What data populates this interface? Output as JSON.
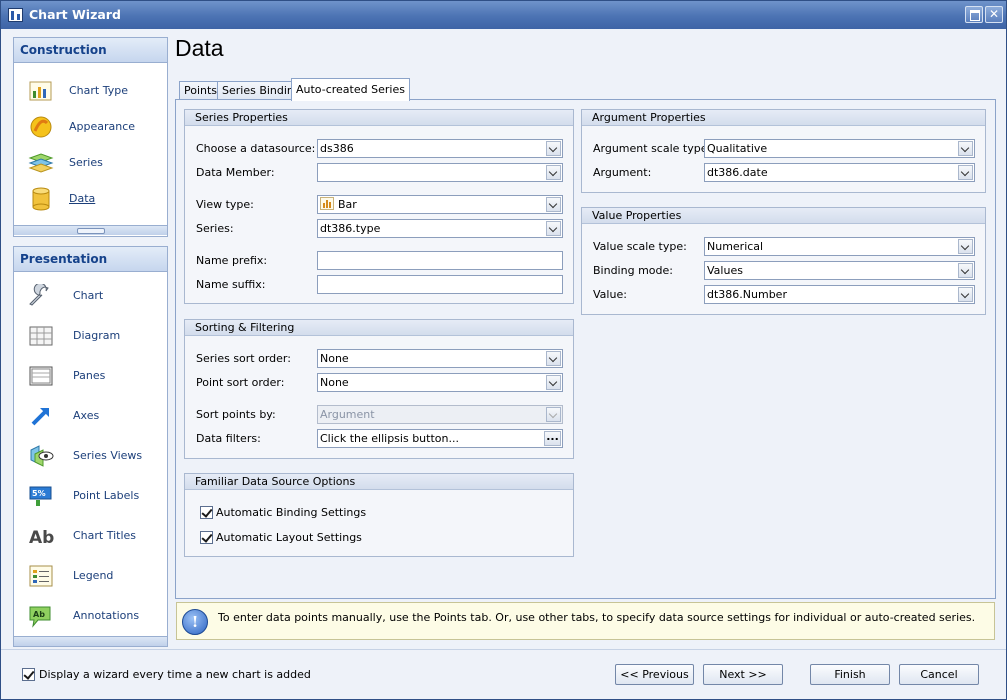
{
  "window": {
    "title": "Chart Wizard"
  },
  "nav": {
    "construction": {
      "header": "Construction",
      "items": [
        {
          "label": "Chart Type",
          "icon": "chart-type-icon"
        },
        {
          "label": "Appearance",
          "icon": "appearance-icon"
        },
        {
          "label": "Series",
          "icon": "series-icon"
        },
        {
          "label": "Data",
          "icon": "data-icon",
          "active": true
        }
      ]
    },
    "presentation": {
      "header": "Presentation",
      "items": [
        {
          "label": "Chart",
          "icon": "wrench-icon"
        },
        {
          "label": "Diagram",
          "icon": "diagram-icon"
        },
        {
          "label": "Panes",
          "icon": "panes-icon"
        },
        {
          "label": "Axes",
          "icon": "axes-icon"
        },
        {
          "label": "Series Views",
          "icon": "series-views-icon"
        },
        {
          "label": "Point Labels",
          "icon": "point-labels-icon"
        },
        {
          "label": "Chart Titles",
          "icon": "chart-titles-icon"
        },
        {
          "label": "Legend",
          "icon": "legend-icon"
        },
        {
          "label": "Annotations",
          "icon": "annotations-icon"
        }
      ]
    }
  },
  "page": {
    "title": "Data"
  },
  "tabs": [
    "Points",
    "Series Binding",
    "Auto-created Series"
  ],
  "series_properties": {
    "header": "Series Properties",
    "datasource_label": "Choose a datasource:",
    "datasource_value": "ds386",
    "data_member_label": "Data Member:",
    "data_member_value": "",
    "view_type_label": "View type:",
    "view_type_value": "Bar",
    "series_label": "Series:",
    "series_value": "dt386.type",
    "name_prefix_label": "Name prefix:",
    "name_prefix_value": "",
    "name_suffix_label": "Name suffix:",
    "name_suffix_value": ""
  },
  "sorting": {
    "header": "Sorting & Filtering",
    "series_sort_label": "Series sort order:",
    "series_sort_value": "None",
    "point_sort_label": "Point sort order:",
    "point_sort_value": "None",
    "sort_by_label": "Sort points by:",
    "sort_by_value": "Argument",
    "filters_label": "Data filters:",
    "filters_value": "Click the ellipsis button...",
    "ellipsis": "..."
  },
  "familiar": {
    "header": "Familiar Data Source Options",
    "auto_binding_label": "Automatic Binding Settings",
    "auto_binding_checked": true,
    "auto_layout_label": "Automatic Layout Settings",
    "auto_layout_checked": true
  },
  "argument_properties": {
    "header": "Argument Properties",
    "scale_type_label": "Argument scale type:",
    "scale_type_value": "Qualitative",
    "argument_label": "Argument:",
    "argument_value": "dt386.date"
  },
  "value_properties": {
    "header": "Value Properties",
    "scale_type_label": "Value scale type:",
    "scale_type_value": "Numerical",
    "binding_mode_label": "Binding mode:",
    "binding_mode_value": "Values",
    "value_label": "Value:",
    "value_value": "dt386.Number"
  },
  "info": {
    "message": "To enter data points manually, use the Points tab. Or, use other tabs, to specify data source settings for individual or auto-created series."
  },
  "footer": {
    "show_wizard_label": "Display a wizard every time a new chart is added",
    "show_wizard_checked": true,
    "previous_label": "<< Previous",
    "next_label": "Next >>",
    "finish_label": "Finish",
    "cancel_label": "Cancel"
  }
}
